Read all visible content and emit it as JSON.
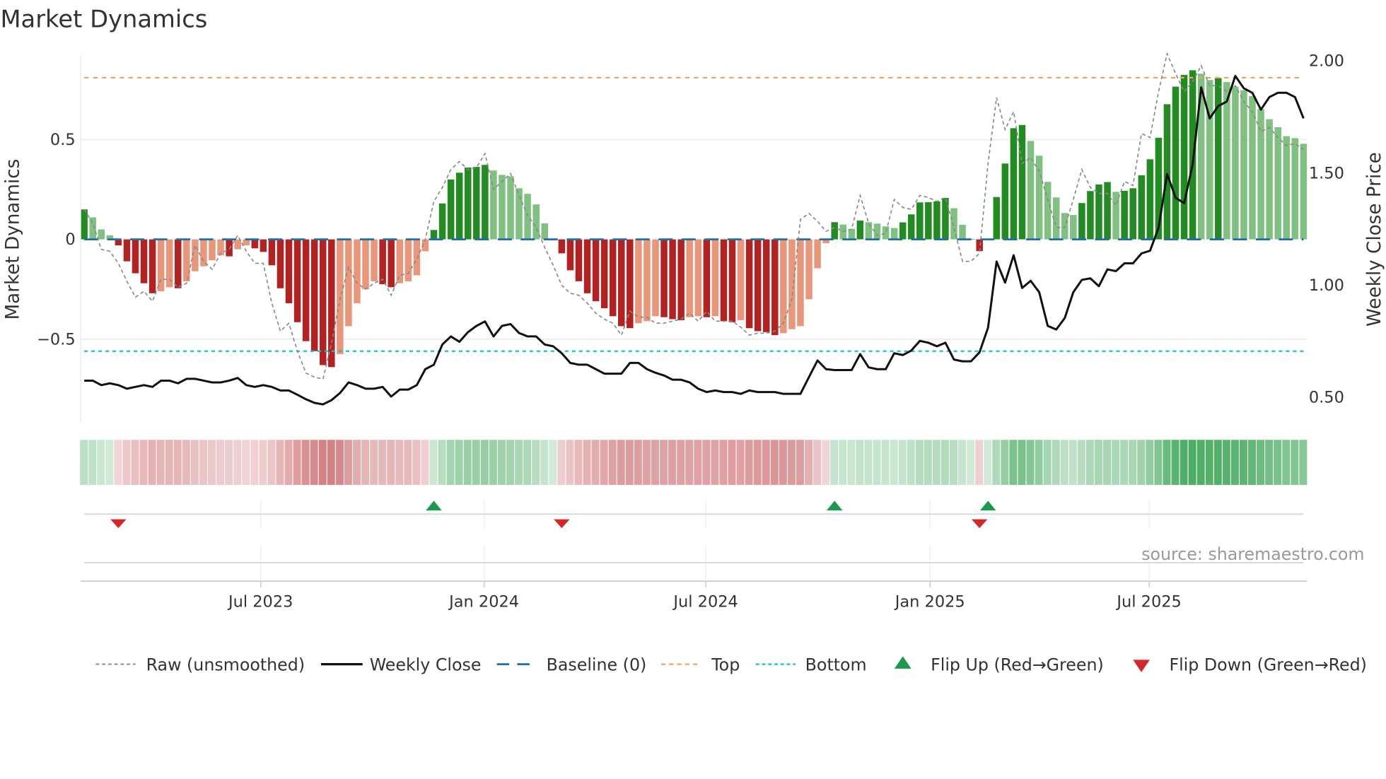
{
  "title": "Market Dynamics",
  "source": "source: sharemaestro.com",
  "colors": {
    "up_strong": "#228b22",
    "up_weak": "#80c080",
    "down_strong": "#b22222",
    "down_weak": "#e9967a",
    "raw": "#888888",
    "close": "#111111",
    "baseline": "#1f6fa8",
    "top": "#f4a460",
    "bottom": "#17becf",
    "flip_up": "#1a9a4a",
    "flip_down": "#d62728",
    "strip_green": "#2e9e4a",
    "strip_red": "#c0484c"
  },
  "chart_data": {
    "type": "bar",
    "title": "Market Dynamics",
    "ylabel": "Market Dynamics",
    "ylabel_right": "Weekly Close Price",
    "ylim": [
      -0.83,
      0.92
    ],
    "ylim_right": [
      0.38,
      2.02
    ],
    "y_ticks": [
      {
        "v": 0.5,
        "label": "0.5"
      },
      {
        "v": 0,
        "label": "0"
      },
      {
        "v": -0.5,
        "label": "−0.5"
      }
    ],
    "y_ticks_right": [
      {
        "v": 2.0,
        "label": "2.00"
      },
      {
        "v": 1.5,
        "label": "1.50"
      },
      {
        "v": 1.0,
        "label": "1.00"
      },
      {
        "v": 0.5,
        "label": "0.50"
      }
    ],
    "x_ticks": [
      {
        "label": "Jul 2023",
        "week": 20.7
      },
      {
        "label": "Jan 2024",
        "week": 46.9
      },
      {
        "label": "Jul 2024",
        "week": 72.9
      },
      {
        "label": "Jan 2025",
        "week": 99.2
      },
      {
        "label": "Jul 2025",
        "week": 124.9
      }
    ],
    "top_level": 0.81,
    "bottom_level": -0.56,
    "baseline": 0,
    "smoothed": [
      0.15,
      0.11,
      0.05,
      0.02,
      -0.03,
      -0.11,
      -0.17,
      -0.22,
      -0.27,
      -0.26,
      -0.24,
      -0.245,
      -0.21,
      -0.16,
      -0.135,
      -0.105,
      -0.08,
      -0.085,
      -0.05,
      -0.03,
      -0.045,
      -0.063,
      -0.13,
      -0.245,
      -0.32,
      -0.415,
      -0.51,
      -0.56,
      -0.63,
      -0.64,
      -0.575,
      -0.435,
      -0.32,
      -0.25,
      -0.21,
      -0.225,
      -0.24,
      -0.22,
      -0.21,
      -0.18,
      -0.06,
      0.047,
      0.18,
      0.3,
      0.334,
      0.36,
      0.363,
      0.373,
      0.345,
      0.323,
      0.316,
      0.256,
      0.228,
      0.175,
      0.08,
      0.003,
      -0.07,
      -0.155,
      -0.21,
      -0.27,
      -0.31,
      -0.345,
      -0.385,
      -0.435,
      -0.445,
      -0.42,
      -0.41,
      -0.385,
      -0.39,
      -0.4,
      -0.405,
      -0.39,
      -0.385,
      -0.39,
      -0.385,
      -0.41,
      -0.415,
      -0.405,
      -0.445,
      -0.46,
      -0.465,
      -0.48,
      -0.47,
      -0.45,
      -0.435,
      -0.3,
      -0.145,
      -0.02,
      0.086,
      0.074,
      0.053,
      0.094,
      0.086,
      0.079,
      0.065,
      0.057,
      0.085,
      0.125,
      0.185,
      0.186,
      0.19,
      0.208,
      0.156,
      0.073,
      0.002,
      -0.059,
      0.001,
      0.212,
      0.38,
      0.557,
      0.573,
      0.493,
      0.419,
      0.288,
      0.21,
      0.132,
      0.122,
      0.182,
      0.242,
      0.275,
      0.287,
      0.238,
      0.243,
      0.256,
      0.321,
      0.401,
      0.509,
      0.677,
      0.765,
      0.824,
      0.847,
      0.83,
      0.798,
      0.808,
      0.788,
      0.765,
      0.747,
      0.717,
      0.653,
      0.602,
      0.562,
      0.517,
      0.507,
      0.479
    ],
    "raw": [
      0.15,
      0.08,
      -0.05,
      -0.06,
      -0.12,
      -0.21,
      -0.29,
      -0.26,
      -0.31,
      -0.2,
      -0.2,
      -0.24,
      -0.22,
      -0.03,
      -0.11,
      -0.15,
      -0.07,
      -0.05,
      0.02,
      -0.06,
      -0.12,
      -0.12,
      -0.32,
      -0.46,
      -0.42,
      -0.56,
      -0.67,
      -0.69,
      -0.7,
      -0.52,
      -0.3,
      -0.14,
      -0.22,
      -0.25,
      -0.22,
      -0.2,
      -0.28,
      -0.18,
      -0.17,
      -0.1,
      0.0,
      0.19,
      0.26,
      0.35,
      0.39,
      0.35,
      0.36,
      0.43,
      0.25,
      0.29,
      0.33,
      0.22,
      0.12,
      0.06,
      -0.04,
      -0.13,
      -0.23,
      -0.27,
      -0.28,
      -0.32,
      -0.37,
      -0.4,
      -0.42,
      -0.48,
      -0.36,
      -0.39,
      -0.39,
      -0.42,
      -0.42,
      -0.41,
      -0.4,
      -0.37,
      -0.41,
      -0.36,
      -0.41,
      -0.41,
      -0.41,
      -0.44,
      -0.48,
      -0.47,
      -0.47,
      -0.46,
      -0.42,
      -0.3,
      0.1,
      0.13,
      0.09,
      0.04,
      0.06,
      0.04,
      0.05,
      0.22,
      0.08,
      0.02,
      0.03,
      0.2,
      0.16,
      0.15,
      0.22,
      0.21,
      0.19,
      0.21,
      0.06,
      -0.11,
      -0.11,
      -0.07,
      0.38,
      0.71,
      0.55,
      0.64,
      0.38,
      0.41,
      0.34,
      0.2,
      0.06,
      0.06,
      0.2,
      0.35,
      0.26,
      0.23,
      0.23,
      0.17,
      0.29,
      0.27,
      0.53,
      0.51,
      0.74,
      0.93,
      0.83,
      0.74,
      0.79,
      0.87,
      0.77,
      0.77,
      0.74,
      0.77,
      0.69,
      0.64,
      0.54,
      0.56,
      0.51,
      0.47,
      0.48,
      0.45
    ],
    "weekly_close": [
      0.575,
      0.575,
      0.555,
      0.563,
      0.555,
      0.539,
      0.547,
      0.555,
      0.547,
      0.575,
      0.575,
      0.563,
      0.583,
      0.583,
      0.575,
      0.567,
      0.567,
      0.575,
      0.587,
      0.555,
      0.547,
      0.555,
      0.547,
      0.531,
      0.531,
      0.512,
      0.492,
      0.476,
      0.469,
      0.488,
      0.52,
      0.567,
      0.555,
      0.539,
      0.539,
      0.547,
      0.504,
      0.535,
      0.535,
      0.555,
      0.626,
      0.646,
      0.736,
      0.772,
      0.748,
      0.791,
      0.819,
      0.839,
      0.772,
      0.819,
      0.827,
      0.787,
      0.772,
      0.772,
      0.736,
      0.728,
      0.697,
      0.654,
      0.646,
      0.646,
      0.626,
      0.606,
      0.606,
      0.606,
      0.654,
      0.654,
      0.626,
      0.61,
      0.598,
      0.579,
      0.579,
      0.567,
      0.539,
      0.524,
      0.531,
      0.524,
      0.524,
      0.516,
      0.531,
      0.524,
      0.524,
      0.524,
      0.516,
      0.516,
      0.516,
      0.591,
      0.665,
      0.626,
      0.622,
      0.622,
      0.622,
      0.693,
      0.634,
      0.626,
      0.626,
      0.697,
      0.689,
      0.709,
      0.752,
      0.744,
      0.728,
      0.744,
      0.669,
      0.661,
      0.661,
      0.701,
      0.811,
      1.106,
      1.012,
      1.134,
      0.988,
      1.02,
      0.969,
      0.819,
      0.803,
      0.854,
      0.969,
      1.024,
      1.031,
      0.996,
      1.071,
      1.063,
      1.098,
      1.098,
      1.142,
      1.154,
      1.256,
      1.496,
      1.39,
      1.366,
      1.539,
      1.882,
      1.744,
      1.799,
      1.819,
      1.933,
      1.878,
      1.858,
      1.783,
      1.839,
      1.858,
      1.858,
      1.839,
      1.744
    ],
    "flips": {
      "up": [
        41,
        88,
        106
      ],
      "down": [
        4,
        56,
        105
      ]
    },
    "legend": {
      "placement": "bottom",
      "items": [
        {
          "key": "raw",
          "label": "Raw (unsmoothed)"
        },
        {
          "key": "close",
          "label": "Weekly Close"
        },
        {
          "key": "baseline",
          "label": "Baseline (0)"
        },
        {
          "key": "top",
          "label": "Top"
        },
        {
          "key": "bottom",
          "label": "Bottom"
        },
        {
          "key": "flip_up",
          "label": "Flip Up (Red→Green)"
        },
        {
          "key": "flip_down",
          "label": "Flip Down (Green→Red)"
        }
      ]
    }
  }
}
